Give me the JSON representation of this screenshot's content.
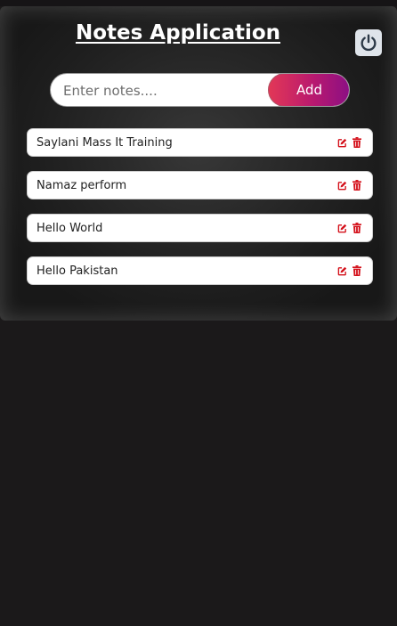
{
  "app": {
    "title": "Notes Application"
  },
  "header": {
    "power_icon": "power-icon"
  },
  "composer": {
    "placeholder": "Enter notes....",
    "value": "",
    "add_label": "Add"
  },
  "notes": [
    {
      "text": "Saylani Mass It Training"
    },
    {
      "text": "Namaz perform"
    },
    {
      "text": "Hello World"
    },
    {
      "text": "Hello Pakistan"
    }
  ],
  "icons": {
    "edit": "edit-icon",
    "delete": "trash-icon"
  },
  "colors": {
    "page_background": "#1b191a",
    "accent_start": "#e33856",
    "accent_end": "#8a0f84",
    "icon_red": "#d4111b",
    "power_button_bg": "#dfe4ea",
    "power_icon": "#2d3a48"
  }
}
